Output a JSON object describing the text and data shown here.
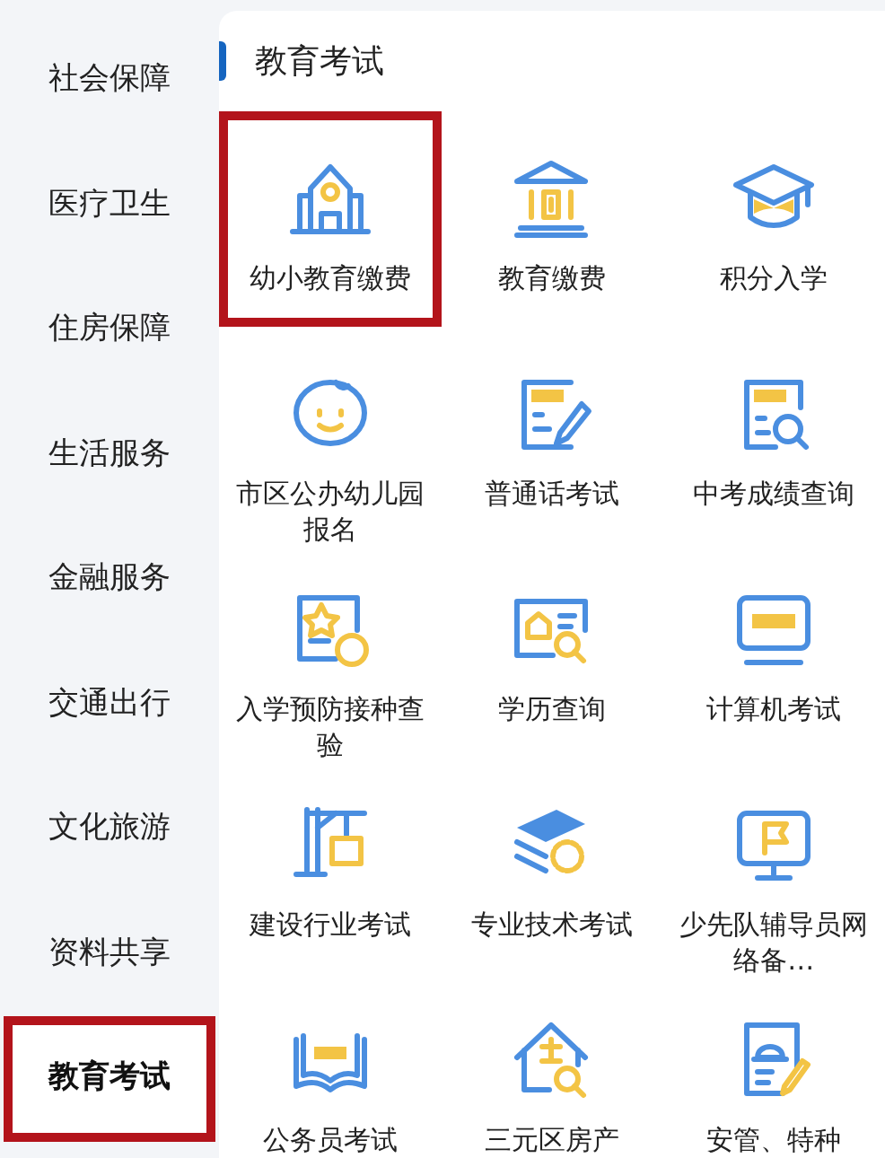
{
  "sidebar": {
    "items": [
      {
        "label": "社会保障",
        "selected": false,
        "highlighted": false
      },
      {
        "label": "医疗卫生",
        "selected": false,
        "highlighted": false
      },
      {
        "label": "住房保障",
        "selected": false,
        "highlighted": false
      },
      {
        "label": "生活服务",
        "selected": false,
        "highlighted": false
      },
      {
        "label": "金融服务",
        "selected": false,
        "highlighted": false
      },
      {
        "label": "交通出行",
        "selected": false,
        "highlighted": false
      },
      {
        "label": "文化旅游",
        "selected": false,
        "highlighted": false
      },
      {
        "label": "资料共享",
        "selected": false,
        "highlighted": false
      },
      {
        "label": "教育考试",
        "selected": true,
        "highlighted": true
      }
    ]
  },
  "section": {
    "title": "教育考试",
    "items": [
      {
        "label": "幼小教育缴费",
        "highlighted": true
      },
      {
        "label": "教育缴费",
        "highlighted": false
      },
      {
        "label": "积分入学",
        "highlighted": false
      },
      {
        "label": "市区公办幼儿园报名",
        "highlighted": false
      },
      {
        "label": "普通话考试",
        "highlighted": false
      },
      {
        "label": "中考成绩查询",
        "highlighted": false
      },
      {
        "label": "入学预防接种查验",
        "highlighted": false
      },
      {
        "label": "学历查询",
        "highlighted": false
      },
      {
        "label": "计算机考试",
        "highlighted": false
      },
      {
        "label": "建设行业考试",
        "highlighted": false
      },
      {
        "label": "专业技术考试",
        "highlighted": false
      },
      {
        "label": "少先队辅导员网络备…",
        "highlighted": false
      },
      {
        "label": "公务员考试",
        "highlighted": false
      },
      {
        "label": "三元区房产",
        "highlighted": false
      },
      {
        "label": "安管、特种",
        "highlighted": false
      }
    ]
  }
}
